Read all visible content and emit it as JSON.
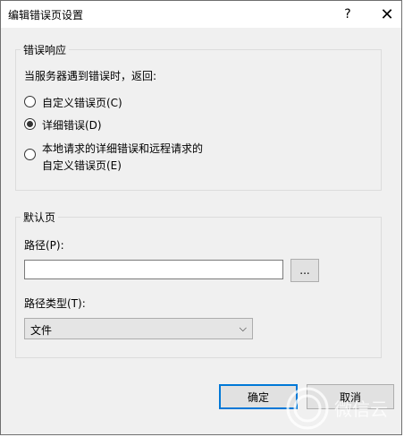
{
  "window": {
    "title": "编辑错误页设置",
    "help_label": "?",
    "close_label": "✕"
  },
  "error_response": {
    "legend": "错误响应",
    "prompt": "当服务器遇到错误时，返回:",
    "options": [
      {
        "label": "自定义错误页(C)",
        "checked": false
      },
      {
        "label": "详细错误(D)",
        "checked": true
      },
      {
        "label_line1": "本地请求的详细错误和远程请求的",
        "label_line2": "自定义错误页(E)",
        "checked": false
      }
    ]
  },
  "default_page": {
    "legend": "默认页",
    "path_label": "路径(P):",
    "path_value": "",
    "browse_label": "...",
    "path_type_label": "路径类型(T):",
    "path_type_value": "文件"
  },
  "buttons": {
    "ok": "确定",
    "cancel": "取消"
  },
  "watermark": {
    "text": "微信云"
  }
}
